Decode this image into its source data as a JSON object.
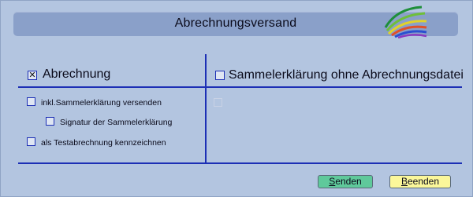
{
  "window": {
    "title": "Abrechnungsversand"
  },
  "left_section": {
    "heading": "Abrechnung",
    "heading_checked": true,
    "options": [
      {
        "label": "inkl.Sammelerklärung versenden",
        "checked": false
      },
      {
        "label": "Signatur der Sammelerklärung",
        "checked": false
      },
      {
        "label": "als Testabrechnung kennzeichnen",
        "checked": false
      }
    ]
  },
  "right_section": {
    "heading": "Sammelerklärung ohne Abrechnungsdatei",
    "heading_checked": false,
    "disabled_option": {
      "label": "",
      "checked": false
    }
  },
  "buttons": {
    "send_first": "S",
    "send_rest": "enden",
    "quit_first": "B",
    "quit_rest": "eenden"
  },
  "colors": {
    "accent": "#1c2fb5",
    "send_button": "#5fc99b",
    "quit_button": "#fbf79a"
  }
}
